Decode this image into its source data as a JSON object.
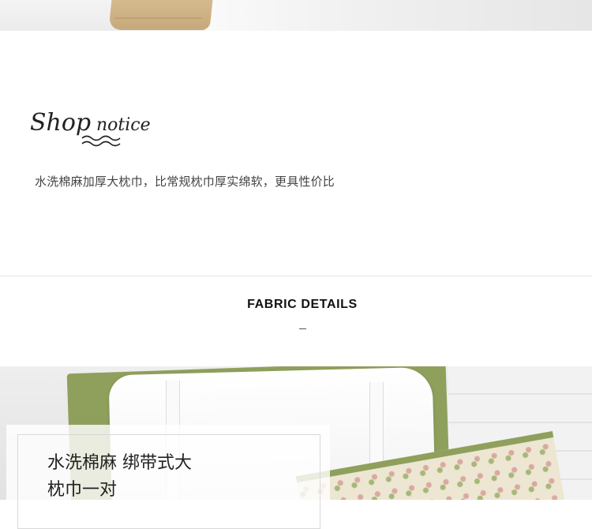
{
  "notice": {
    "logo_text": "Shop notice",
    "text": "水洗棉麻加厚大枕巾，比常规枕巾厚实绵软，更具性价比"
  },
  "fabric": {
    "title": "FABRIC DETAILS",
    "dash": "–"
  },
  "product_card": {
    "line1": "水洗棉麻 绑带式大",
    "line2": "枕巾一对"
  },
  "colors": {
    "accent_green": "#8fa05c",
    "tan": "#c7a97a"
  }
}
